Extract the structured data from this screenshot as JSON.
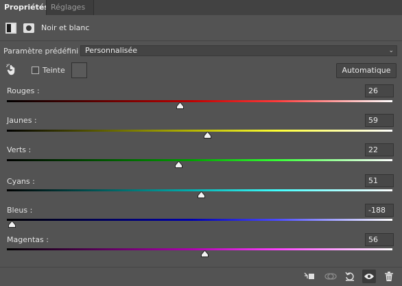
{
  "tabs": [
    {
      "label": "Propriétés",
      "active": true
    },
    {
      "label": "Réglages",
      "active": false
    }
  ],
  "header": {
    "title": "Noir et blanc",
    "icons": [
      "adjustment-layer-icon",
      "mask-icon"
    ]
  },
  "preset": {
    "label": "Paramètre prédéfini :",
    "value": "Personnalisée"
  },
  "tint": {
    "label": "Teinte",
    "checked": false,
    "swatch_color": "#5a5a5a"
  },
  "auto_button": "Automatique",
  "sliders": [
    {
      "label": "Rouges :",
      "value": "26",
      "gradient": "linear-gradient(to right, #000000, #c00000 48%, #ff3a3a 70%, #ffffff)",
      "fraction": 0.45
    },
    {
      "label": "Jaunes :",
      "value": "59",
      "gradient": "linear-gradient(to right, #000000, #b5b500 48%, #ffff33 70%, #ffffff)",
      "fraction": 0.52
    },
    {
      "label": "Verts :",
      "value": "22",
      "gradient": "linear-gradient(to right, #000000, #00a000 48%, #35ff35 70%, #ffffff)",
      "fraction": 0.445
    },
    {
      "label": "Cyans :",
      "value": "51",
      "gradient": "linear-gradient(to right, #000000, #00b0b0 48%, #40ffff 70%, #ffffff)",
      "fraction": 0.505
    },
    {
      "label": "Bleus :",
      "value": "-188",
      "gradient": "linear-gradient(to right, #000000, #0000b0 48%, #4a4aff 70%, #ffffff)",
      "fraction": 0.013
    },
    {
      "label": "Magentas :",
      "value": "56",
      "gradient": "linear-gradient(to right, #000000, #b000b0 48%, #ff40ff 70%, #ffffff)",
      "fraction": 0.513
    }
  ],
  "bottom_icons": [
    "clip-to-layer-icon",
    "view-previous-state-icon",
    "reset-icon",
    "visibility-eye-icon",
    "trash-icon"
  ]
}
